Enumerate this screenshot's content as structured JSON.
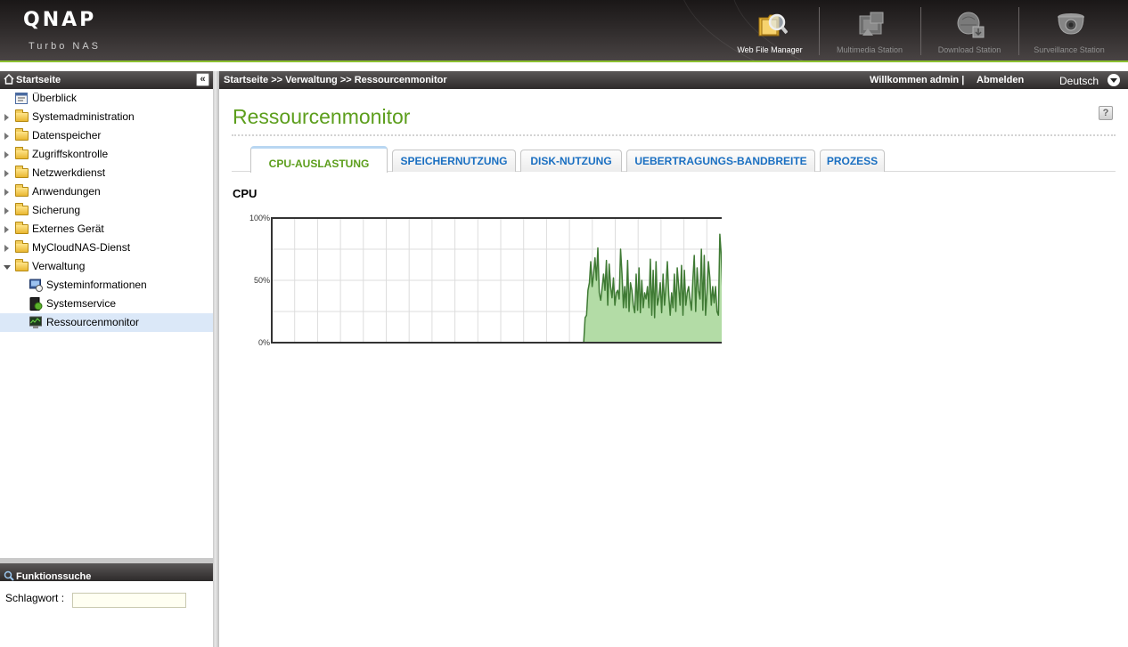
{
  "banner": {
    "logo": "QNAP",
    "subtitle": "Turbo NAS",
    "apps": [
      {
        "label": "Web File Manager",
        "icon": "web-file-manager-icon",
        "color": "#ffffff"
      },
      {
        "label": "Multimedia Station",
        "icon": "multimedia-station-icon",
        "color": "#8f8f8f"
      },
      {
        "label": "Download Station",
        "icon": "download-station-icon",
        "color": "#8f8f8f"
      },
      {
        "label": "Surveillance Station",
        "icon": "surveillance-station-icon",
        "color": "#8f8f8f"
      }
    ]
  },
  "sidebar": {
    "title": "Startseite",
    "collapse_glyph": "«",
    "tree": [
      {
        "label": "Überblick",
        "icon": "overview-icon"
      },
      {
        "label": "Systemadministration",
        "icon": "folder-icon"
      },
      {
        "label": "Datenspeicher",
        "icon": "folder-icon"
      },
      {
        "label": "Zugriffskontrolle",
        "icon": "folder-icon"
      },
      {
        "label": "Netzwerkdienst",
        "icon": "folder-icon"
      },
      {
        "label": "Anwendungen",
        "icon": "folder-icon"
      },
      {
        "label": "Sicherung",
        "icon": "folder-icon"
      },
      {
        "label": "Externes Gerät",
        "icon": "folder-icon"
      },
      {
        "label": "MyCloudNAS-Dienst",
        "icon": "folder-icon"
      },
      {
        "label": "Verwaltung",
        "icon": "folder-open-icon",
        "expanded": true
      },
      {
        "label": "Systeminformationen",
        "icon": "system-info-icon"
      },
      {
        "label": "Systemservice",
        "icon": "system-service-icon"
      },
      {
        "label": "Ressourcenmonitor",
        "icon": "resource-monitor-icon",
        "selected": true
      }
    ],
    "search": {
      "title": "Funktionssuche",
      "keyword_label": "Schlagwort :",
      "keyword_value": ""
    }
  },
  "header": {
    "breadcrumb": "Startseite >> Verwaltung >> Ressourcenmonitor",
    "welcome": "Willkommen admin",
    "separator": "|",
    "logout": "Abmelden",
    "language": "Deutsch"
  },
  "main": {
    "title": "Ressourcenmonitor",
    "help": "?",
    "tabs": [
      {
        "label": "CPU-AUSLASTUNG",
        "active": true
      },
      {
        "label": "SPEICHERNUTZUNG"
      },
      {
        "label": "DISK-NUTZUNG"
      },
      {
        "label": "UEBERTRAGUNGS-BANDBREITE"
      },
      {
        "label": "PROZESS"
      }
    ],
    "section_heading": "CPU"
  },
  "colors": {
    "accent_green": "#5c9e1c",
    "tab_blue": "#1a6fc1",
    "line": "#3f7a34",
    "fill": "#b3dca6"
  },
  "chart_data": {
    "type": "area",
    "title": "",
    "xlabel": "",
    "ylabel": "",
    "ylim": [
      0,
      100
    ],
    "yticks": [
      "0%",
      "50%",
      "100%"
    ],
    "grid": true,
    "series": [
      {
        "values": [
          null,
          null,
          null,
          null,
          null,
          null,
          null,
          null,
          null,
          null,
          null,
          null,
          null,
          null,
          null,
          null,
          null,
          null,
          null,
          null,
          null,
          null,
          null,
          null,
          null,
          null,
          null,
          null,
          null,
          null,
          null,
          null,
          null,
          null,
          null,
          null,
          null,
          null,
          null,
          null,
          null,
          null,
          null,
          null,
          null,
          null,
          null,
          null,
          null,
          null,
          null,
          null,
          null,
          null,
          null,
          null,
          null,
          null,
          null,
          null,
          null,
          null,
          null,
          null,
          null,
          null,
          null,
          null,
          null,
          null,
          null,
          null,
          null,
          null,
          null,
          null,
          null,
          null,
          null,
          null,
          null,
          null,
          null,
          null,
          null,
          null,
          null,
          null,
          null,
          null,
          null,
          null,
          null,
          null,
          null,
          null,
          null,
          null,
          null,
          null,
          null,
          null,
          null,
          null,
          null,
          null,
          null,
          null,
          null,
          null,
          null,
          null,
          null,
          null,
          null,
          null,
          null,
          null,
          null,
          null,
          null,
          null,
          null,
          null,
          null,
          null,
          null,
          null,
          null,
          null,
          null,
          null,
          null,
          null,
          null,
          null,
          null,
          null,
          null,
          null,
          null,
          null,
          null,
          null,
          null,
          null,
          null,
          null,
          null,
          null,
          null,
          null,
          null,
          null,
          null,
          null,
          null,
          null,
          null,
          null,
          null,
          null,
          null,
          null,
          null,
          null,
          null,
          null,
          null,
          null,
          null,
          null,
          null,
          null,
          null,
          null,
          null,
          null,
          null,
          null,
          null,
          null,
          null,
          null,
          null,
          null,
          null,
          null,
          null,
          null,
          null,
          null,
          null,
          null,
          null,
          null,
          null,
          null,
          null,
          null,
          null,
          null,
          null,
          null,
          null,
          null,
          null,
          null,
          null,
          null,
          null,
          null,
          null,
          null,
          null,
          null,
          null,
          null,
          null,
          null,
          0,
          20,
          22,
          42,
          48,
          65,
          45,
          55,
          68,
          50,
          76,
          40,
          34,
          44,
          55,
          42,
          66,
          30,
          63,
          45,
          36,
          52,
          30,
          40,
          42,
          35,
          75,
          55,
          28,
          45,
          28,
          66,
          25,
          48,
          42,
          30,
          24,
          55,
          26,
          60,
          24,
          50,
          28,
          40,
          35,
          45,
          28,
          67,
          22,
          58,
          20,
          65,
          30,
          36,
          48,
          24,
          55,
          30,
          45,
          65,
          38,
          22,
          40,
          28,
          55,
          25,
          60,
          45,
          30,
          62,
          22,
          58,
          30,
          40,
          45,
          35,
          26,
          50,
          70,
          25,
          60,
          42,
          35,
          75,
          26,
          70,
          22,
          40,
          65,
          52,
          30,
          45,
          32,
          45,
          25,
          22,
          87,
          70,
          40,
          48,
          82,
          52,
          35,
          30
        ]
      }
    ]
  }
}
